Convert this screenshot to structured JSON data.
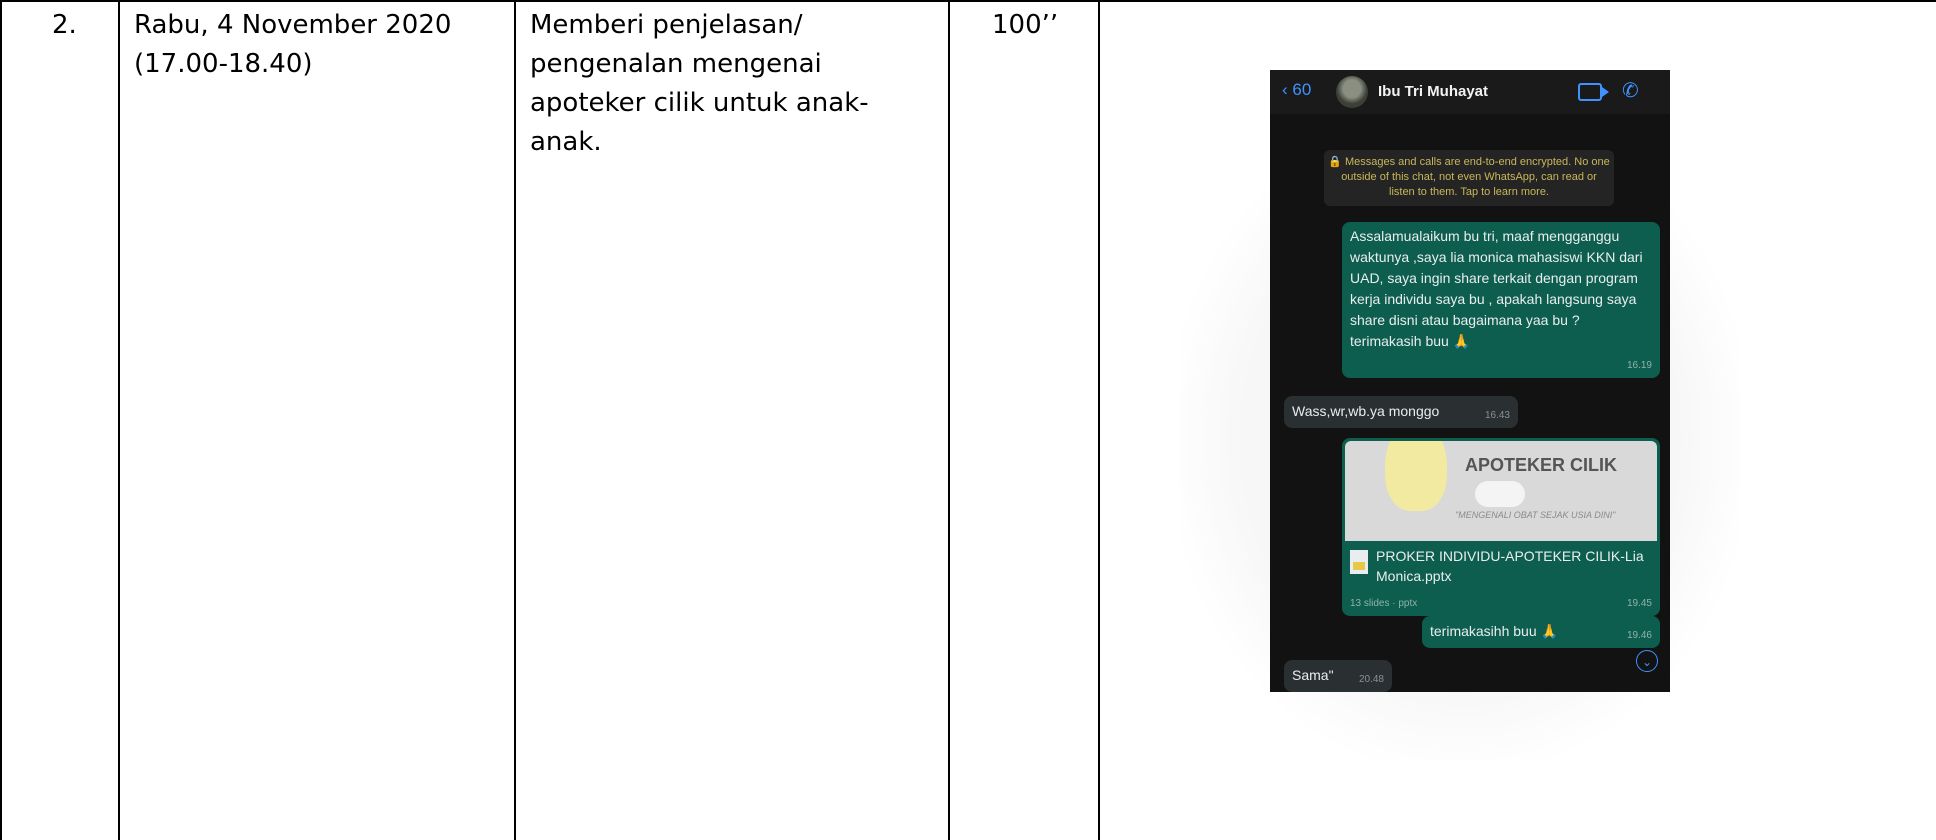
{
  "row": {
    "number": "2.",
    "date": "Rabu, 4 November 2020",
    "time": "(17.00-18.40)",
    "description_lines": [
      "Memberi penjelasan/",
      "pengenalan mengenai",
      "apoteker cilik untuk anak-",
      "anak."
    ],
    "duration": "100’’"
  },
  "chat": {
    "back_count": "60",
    "contact_name": "Ibu Tri Muhayat",
    "encryption_notice": "Messages and calls are end-to-end encrypted. No one outside of this chat, not even WhatsApp, can read or listen to them. Tap to learn more.",
    "messages": [
      {
        "text": "Assalamualaikum bu tri, maaf mengganggu waktunya ,saya lia monica mahasiswi KKN dari UAD, saya ingin share terkait dengan program kerja individu saya bu , apakah langsung saya share disni atau bagaimana yaa bu ? terimakasih buu 🙏",
        "time": "16.19"
      },
      {
        "text": "Wass,wr,wb.ya monggo",
        "time": "16.43"
      },
      {
        "slide_title": "APOTEKER CILIK",
        "slide_sub": "\"MENGENALI OBAT SEJAK USIA DINI\"",
        "file": "PROKER INDIVIDU-APOTEKER CILIK-Lia Monica.pptx",
        "meta": "13 slides · pptx",
        "time": "19.45"
      },
      {
        "text": "terimakasihh buu 🙏",
        "time": "19.46"
      },
      {
        "text": "Sama\"",
        "time": "20.48"
      }
    ]
  }
}
